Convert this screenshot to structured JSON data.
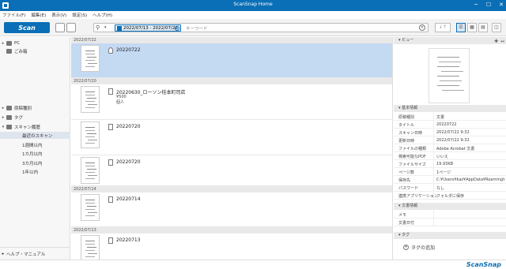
{
  "window": {
    "title": "ScanSnap Home",
    "minimize": "─",
    "maximize": "☐",
    "close": "✕"
  },
  "menu": [
    "ファイル(F)",
    "編集(E)",
    "表示(V)",
    "設定(S)",
    "ヘルプ(H)"
  ],
  "toolbar": {
    "scan_label": "Scan",
    "date_range": "2022/07/13 - 2022/07/26",
    "keyword_placeholder": "キーワード"
  },
  "sidebar": {
    "top": [
      {
        "label": "PC",
        "icon": "pc-icon"
      },
      {
        "label": "ごみ箱",
        "icon": "trash-icon"
      }
    ],
    "groups": [
      {
        "label": "原稿種別",
        "icon": "doc-type-icon"
      },
      {
        "label": "タグ",
        "icon": "tag-icon"
      },
      {
        "label": "スキャン履歴",
        "icon": "history-icon"
      }
    ],
    "history": [
      "最近のスキャン",
      "1週間以内",
      "1カ月以内",
      "3カ月以内",
      "1年以内"
    ],
    "help": "ヘルプ・マニュアル"
  },
  "list": {
    "headers": [
      "2022/07/22",
      "2022/07/20",
      "2022/07/14",
      "2022/07/13"
    ],
    "rows": [
      {
        "name": "20220722",
        "extra1": "",
        "extra2": ""
      },
      {
        "name": "20220630_ローソン桂本町司店",
        "extra1": "¥500",
        "extra2": "個人"
      },
      {
        "name": "20220720",
        "extra1": "",
        "extra2": ""
      },
      {
        "name": "20220720",
        "extra1": "",
        "extra2": ""
      },
      {
        "name": "20220714",
        "extra1": "",
        "extra2": ""
      },
      {
        "name": "20220713",
        "extra1": "",
        "extra2": ""
      }
    ]
  },
  "panel": {
    "preview_header": "ビュー",
    "info_header": "基本情報",
    "props": [
      {
        "k": "原稿種別",
        "v": "文書"
      },
      {
        "k": "タイトル",
        "v": "20220722"
      },
      {
        "k": "スキャン日時",
        "v": "2022/07/22 9:32"
      },
      {
        "k": "更新日時",
        "v": "2022/07/22 9:32"
      },
      {
        "k": "ファイルの種類",
        "v": "Adobe Acrobat 文書"
      },
      {
        "k": "検索可能なPDF",
        "v": "いいえ"
      },
      {
        "k": "ファイルサイズ",
        "v": "19.93KB"
      },
      {
        "k": "ページ数",
        "v": "1ページ"
      },
      {
        "k": "保存先",
        "v": "C:¥Users¥kaz¥AppData¥Roaming¥P..."
      },
      {
        "k": "パスワード",
        "v": "なし"
      },
      {
        "k": "連携アプリケーション",
        "v": "フォルダに保存"
      }
    ],
    "doc_info_header": "文書情報",
    "doc_props": [
      {
        "k": "メモ",
        "v": ""
      },
      {
        "k": "文書日付",
        "v": ""
      }
    ],
    "tag_header": "タグ",
    "add_tag": "タグの追加"
  },
  "brand": "ScanSnap"
}
